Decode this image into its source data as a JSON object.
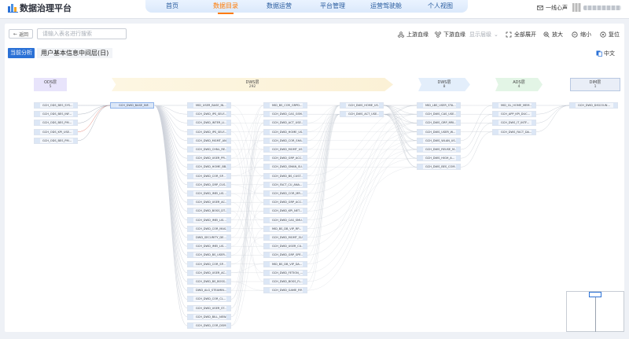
{
  "header": {
    "brand": "数据治理平台",
    "nav": [
      "首页",
      "数据目录",
      "数据运营",
      "平台管理",
      "运营驾驶舱",
      "个人视图"
    ],
    "active_nav": 1,
    "user_label": "一线心声"
  },
  "toolbar": {
    "back_label": "返回",
    "search_placeholder": "请输入表名进行搜索",
    "upstream": "上游血缘",
    "downstream": "下游血缘",
    "show_level": "显示层级",
    "expand_all": "全部展开",
    "zoom_in": "放大",
    "zoom_out": "缩小",
    "reset": "复位",
    "current_tab": "当前分析",
    "page_title": "用户基本信息中间层(日)",
    "lang": "中文"
  },
  "layers": [
    {
      "name": "ODS层",
      "count": "5"
    },
    {
      "name": "DWS层",
      "count": "292"
    },
    {
      "name": "DWS层",
      "count": "8"
    },
    {
      "name": "ADS层",
      "count": "4"
    },
    {
      "name": "DIM层",
      "count": "1"
    }
  ],
  "columns": [
    {
      "nodes": [
        "GCH_ODS_BES_SYS...",
        "GCH_ODS_BES_INF...",
        "GCH_ODS_BES_PM...",
        "GCH_ODS_KPI_USE...",
        "GCH_ODS_BES_PM..."
      ]
    },
    {
      "nodes": [
        "GCH_DWD_BASE_INF..."
      ]
    },
    {
      "nodes": [
        "MID_USER_BASE_IN...",
        "GCH_DWD_IPS_SELF...",
        "GCH_DWD_INTER_LI...",
        "GCH_DWD_IPS_SELF...",
        "GCH_DWD_MGMT_AN...",
        "GCH_DWD_CHNL_RE...",
        "GCH_DWD_USER_PR...",
        "GCH_DWD_HOME_BB...",
        "GCH_DWD_COR_SP...",
        "GCH_DWD_GRP_CUS...",
        "GCH_DWD_IMEI_LIS...",
        "GCH_DWD_USER_AC...",
        "GCH_DWD_BOSS_DT...",
        "GCH_DWD_IMEI_LIS...",
        "GCH_DWD_COR_MAS...",
        "DWD_SECURITY_DE...",
        "GCH_DWD_IMEI_LIS...",
        "GCH_DWD_BS_USER...",
        "GCH_DWD_COR_SP...",
        "GCH_DWD_USER_AC...",
        "GCH_DWD_BS_BOSS...",
        "DWD_ALG_STEAMIN...",
        "GCH_DWD_COR_CL...",
        "GCH_DWD_USER_ST...",
        "GCH_DWD_BILL_NEW...",
        "GCH_DWD_COR_DSM..."
      ]
    },
    {
      "nodes": [
        "MID_BS_COR_GRPD...",
        "GCH_DWD_CAS_GSM...",
        "GCH_DWD_ACT_USE...",
        "GCH_DWD_HOME_US...",
        "GCH_DWD_COR_SHA...",
        "GCH_DWD_MGMT_US...",
        "GCH_DWD_GRP_ACC...",
        "GCH_DWD_SMAN_SU...",
        "GCH_DWD_BS_CUST...",
        "GCH_FACT_CU_ANA...",
        "GCH_DWD_COR_MR...",
        "GCH_DWD_GRP_ACC...",
        "GCH_DWD_KPI_NET...",
        "GCH_DWD_CAS_SMU...",
        "MID_BS_DB_VIP_RP...",
        "GCH_DWD_MGMT_SU...",
        "GCH_DWD_USER_CU...",
        "GCH_DWD_GRP_SPE...",
        "MID_BS_DB_VIP_DA...",
        "GCH_DWD_FETION_...",
        "GCH_DWD_BOSS_FL...",
        "GCH_DWD_GAME_RP..."
      ]
    },
    {
      "nodes": [
        "GCH_DWS_HOME_US...",
        "GCH_DWS_ACT_USE..."
      ]
    },
    {
      "nodes": [
        "MID_LBS_USER_STA...",
        "GCH_DWS_CAS_USE...",
        "GCH_DWS_GRP_MRI...",
        "GCH_DWS_USER_W...",
        "GCH_DWS_WLAN_US...",
        "GCH_DWS_REUSE_M...",
        "GCH_DWS_HIGH_A...",
        "GCH_DWS_BES_COM..."
      ]
    },
    {
      "nodes": [
        "MID_GL_HOME_MEM...",
        "GCH_APP_KPI_DUC...",
        "GCH_DWS_IT_INTF...",
        "GCH_DWS_FACT_DA..."
      ]
    },
    {
      "nodes": [
        "GCH_DWD_DISCOUN..."
      ]
    }
  ]
}
